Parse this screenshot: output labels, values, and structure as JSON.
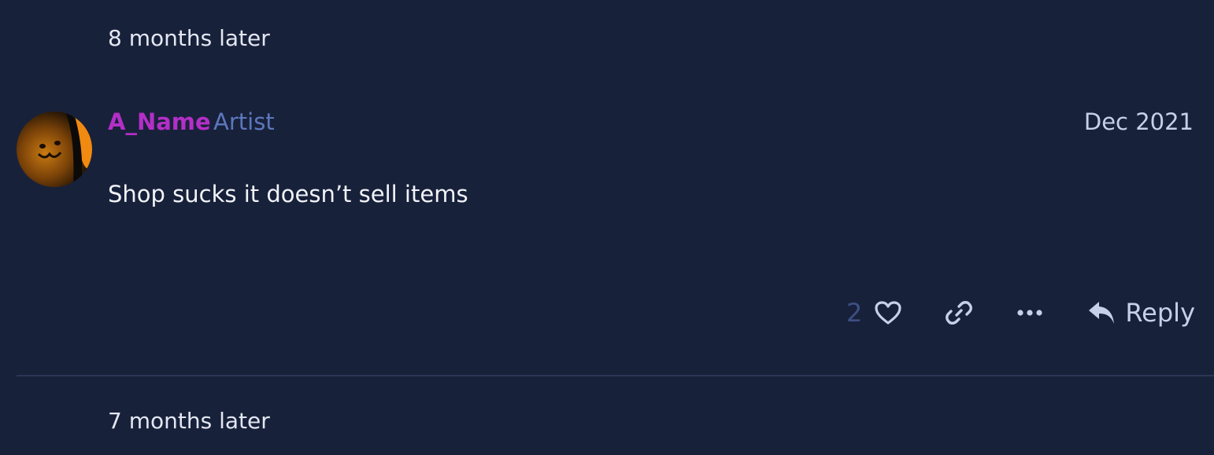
{
  "gap_before": "8 months later",
  "post": {
    "username": "A_Name",
    "user_title": "Artist",
    "date": "Dec 2021",
    "body": "Shop sucks it doesn’t sell items",
    "like_count": "2",
    "reply_label": "Reply"
  },
  "gap_after": "7 months later",
  "colors": {
    "background": "#18213a",
    "username": "#b42fc7",
    "user_title": "#5b78bd",
    "divider": "#2b3655"
  },
  "icons": {
    "like": "heart-icon",
    "link": "link-icon",
    "more": "ellipsis-icon",
    "reply": "reply-arrow-icon"
  }
}
